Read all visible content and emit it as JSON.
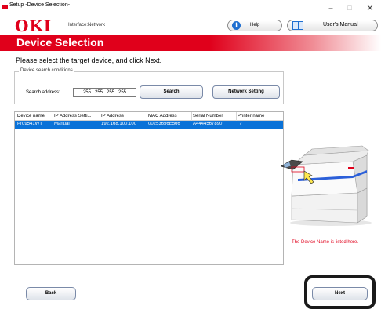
{
  "window": {
    "title": "Setup -Device Selection-",
    "controls": {
      "minimize": "–",
      "maximize": "□",
      "close": "✕"
    }
  },
  "header": {
    "logo": "OKI",
    "interface_label": "Interface:Network",
    "help_label": "Help",
    "help_icon": "info-icon",
    "manual_label": "User's Manual",
    "manual_icon": "book-icon",
    "brand_color": "#e0001b"
  },
  "page": {
    "heading": "Device Selection",
    "instruction": "Please select the target device, and click Next."
  },
  "search": {
    "group_caption": "Device search conditions",
    "address_label": "Search address:",
    "address_value": "255 . 255 . 255 . 255",
    "search_button": "Search",
    "network_setting_button": "Network Setting"
  },
  "device_table": {
    "columns": [
      "Device name",
      "IP Address Setti...",
      "IP Address",
      "MAC Address",
      "Serial Number",
      "Printer name"
    ],
    "rows": [
      {
        "device_name": "Pro9541WT",
        "ip_setting": "Manual",
        "ip_address": "192.168.100.100",
        "mac_address": "00253656E566",
        "serial_number": "A4444567890",
        "printer_name": "\"?\"",
        "selected": true
      }
    ],
    "selection_color": "#0a72d8"
  },
  "illustration": {
    "caption": "The Device Name is listed here."
  },
  "footer": {
    "back_button": "Back",
    "next_button": "Next"
  }
}
